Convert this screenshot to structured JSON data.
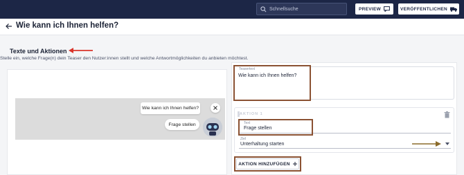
{
  "topbar": {
    "search_placeholder": "Schnellsuche",
    "preview_label": "PREVIEW",
    "publish_label": "VERÖFFENTLICHEN"
  },
  "header": {
    "title": "Wie kann ich Ihnen helfen?"
  },
  "section": {
    "title": "Texte und Aktionen",
    "description": "Stelle ein, welche Frage(n) dein Teaser den Nutzer:innen stellt und welche Antwortmöglichkeiten du anbieten möchtest."
  },
  "preview": {
    "question": "Wie kann ich Ihnen helfen?",
    "answer": "Frage stellen"
  },
  "form": {
    "teaser_label": "Teasertext",
    "teaser_value": "Wie kann ich Ihnen helfen?",
    "action_heading": "AKTION 1",
    "text_label": "Text",
    "text_value": "Frage stellen",
    "ziel_label": "Ziel",
    "ziel_value": "Unterhaltung starten",
    "add_action_label": "AKTION HINZUFÜGEN"
  },
  "colors": {
    "topbar": "#1c2646",
    "highlight": "#8a5132",
    "arrow_red": "#d9342b",
    "arrow_brown": "#8a6a2a"
  }
}
